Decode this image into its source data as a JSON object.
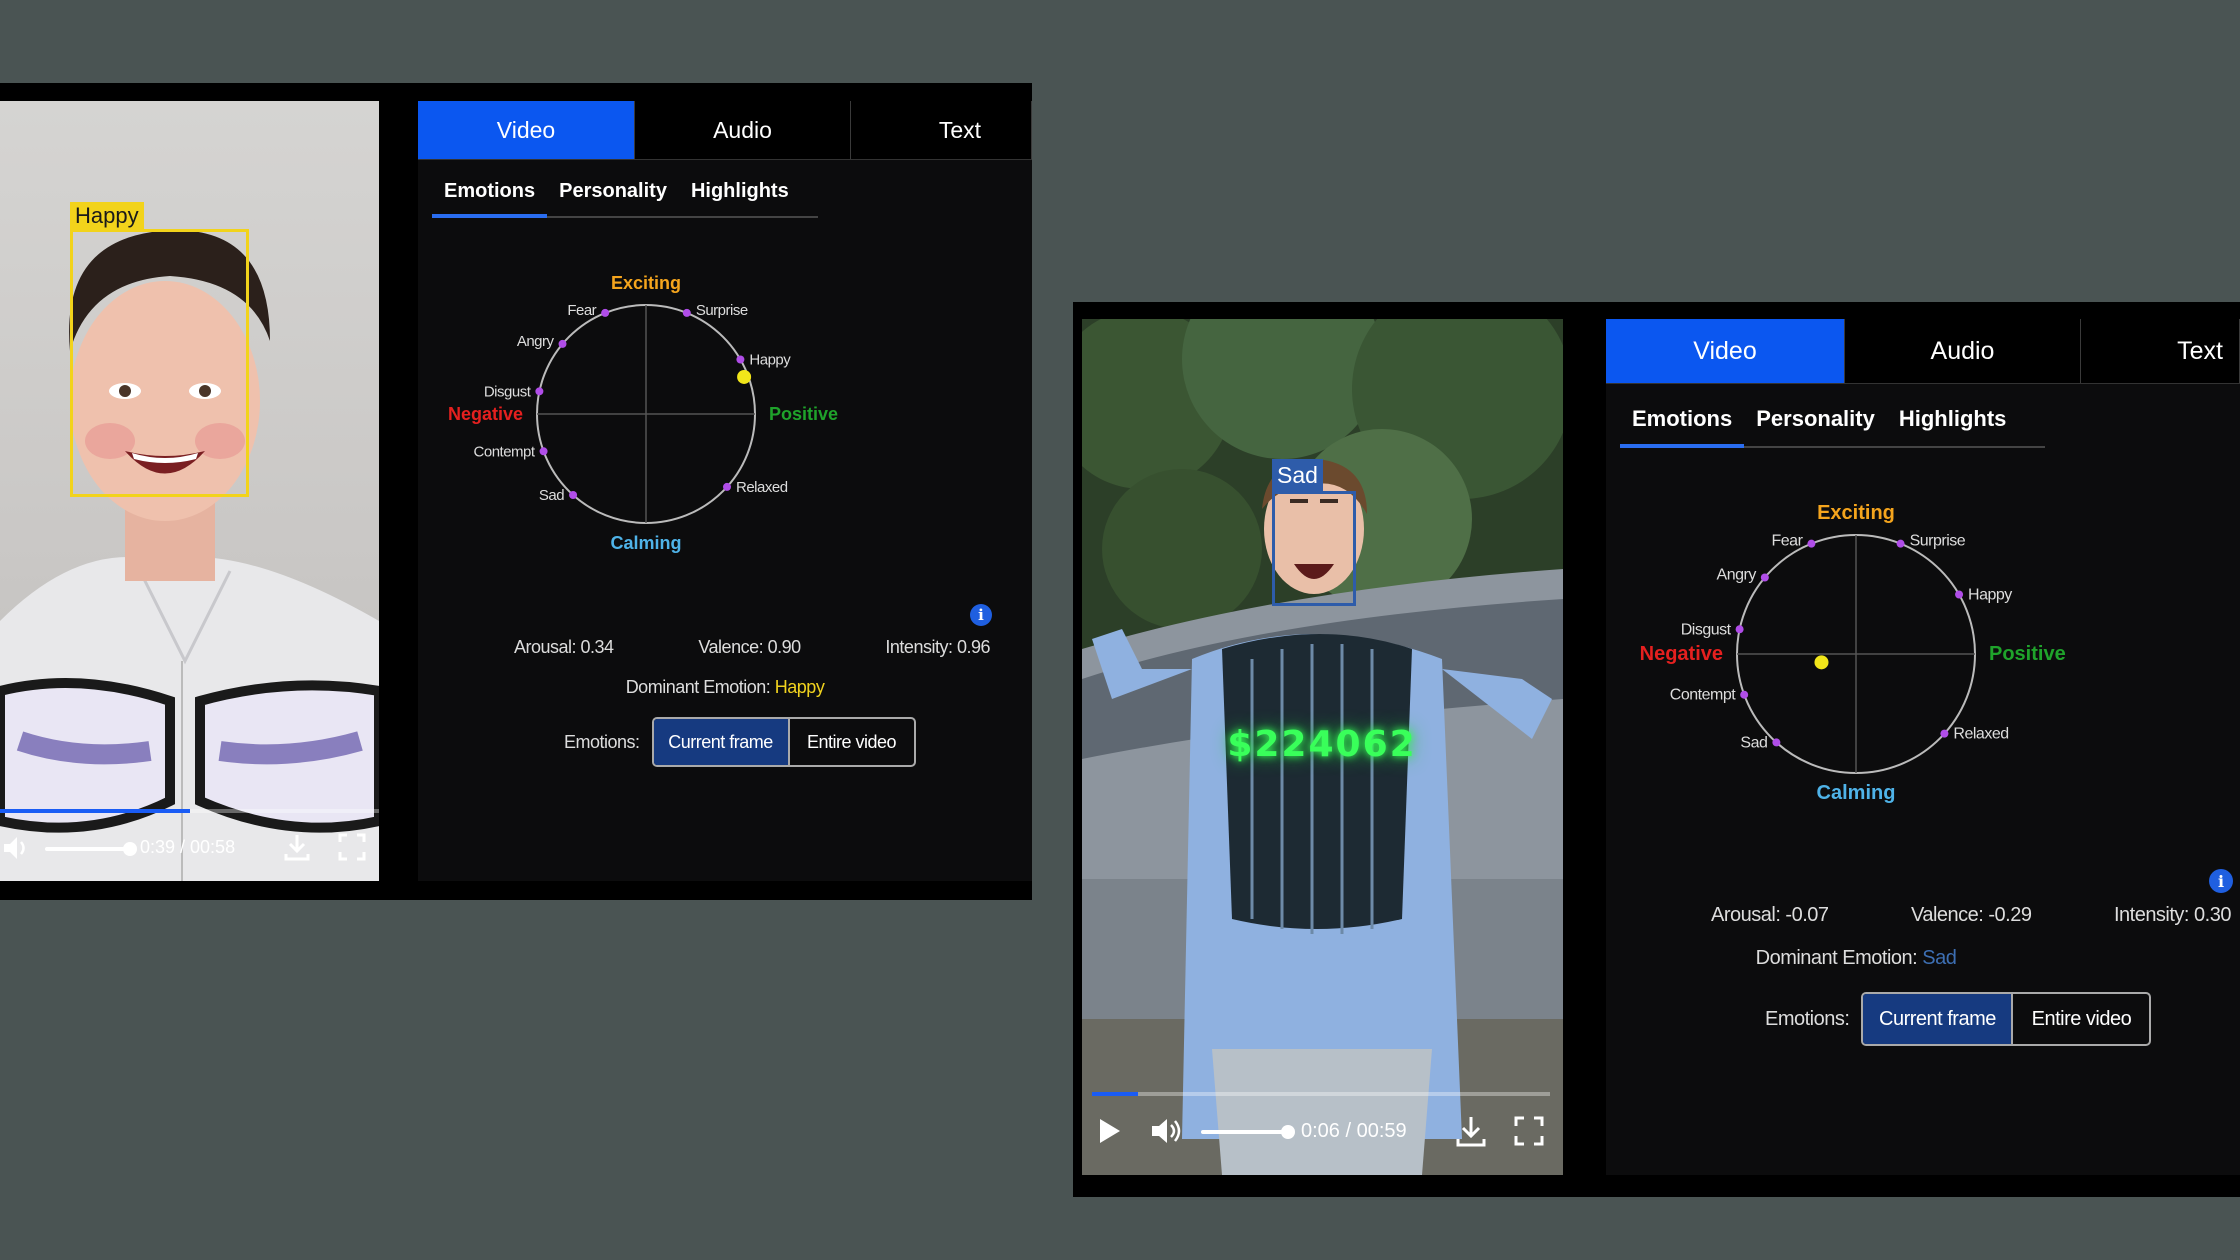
{
  "panels": [
    {
      "tabs": [
        "Video",
        "Audio",
        "Text"
      ],
      "active_tab": 0,
      "subtabs": [
        "Emotions",
        "Personality",
        "Highlights"
      ],
      "active_subtab": 0,
      "wheel": {
        "top_label": "Exciting",
        "bottom_label": "Calming",
        "left_label": "Negative",
        "right_label": "Positive",
        "emotions": [
          {
            "name": "Fear",
            "angle": 112
          },
          {
            "name": "Surprise",
            "angle": 68
          },
          {
            "name": "Angry",
            "angle": 140
          },
          {
            "name": "Happy",
            "angle": 30
          },
          {
            "name": "Disgust",
            "angle": 168
          },
          {
            "name": "Contempt",
            "angle": 200
          },
          {
            "name": "Sad",
            "angle": 228
          },
          {
            "name": "Relaxed",
            "angle": 318
          }
        ],
        "marker": {
          "valence": 0.9,
          "arousal": 0.34
        }
      },
      "metrics": {
        "arousal": "Arousal: 0.34",
        "valence": "Valence: 0.90",
        "intensity": "Intensity: 0.96"
      },
      "dominant_label": "Dominant Emotion:",
      "dominant_value": "Happy",
      "dominant_color": "#f0d21e",
      "emotions_label": "Emotions:",
      "toggle": [
        "Current frame",
        "Entire video"
      ],
      "face_label": "Happy",
      "face_color": "#f2d31b",
      "time": "0:39 / 00:58",
      "overlay_text": "",
      "progress": 0.5
    },
    {
      "tabs": [
        "Video",
        "Audio",
        "Text"
      ],
      "active_tab": 0,
      "subtabs": [
        "Emotions",
        "Personality",
        "Highlights"
      ],
      "active_subtab": 0,
      "wheel": {
        "top_label": "Exciting",
        "bottom_label": "Calming",
        "left_label": "Negative",
        "right_label": "Positive",
        "emotions": [
          {
            "name": "Fear",
            "angle": 112
          },
          {
            "name": "Surprise",
            "angle": 68
          },
          {
            "name": "Angry",
            "angle": 140
          },
          {
            "name": "Happy",
            "angle": 30
          },
          {
            "name": "Disgust",
            "angle": 168
          },
          {
            "name": "Contempt",
            "angle": 200
          },
          {
            "name": "Sad",
            "angle": 228
          },
          {
            "name": "Relaxed",
            "angle": 318
          }
        ],
        "marker": {
          "valence": -0.29,
          "arousal": -0.07
        }
      },
      "metrics": {
        "arousal": "Arousal: -0.07",
        "valence": "Valence: -0.29",
        "intensity": "Intensity: 0.30"
      },
      "dominant_label": "Dominant Emotion:",
      "dominant_value": "Sad",
      "dominant_color": "#3d6fb3",
      "emotions_label": "Emotions:",
      "toggle": [
        "Current frame",
        "Entire video"
      ],
      "face_label": "Sad",
      "face_color": "#2e5caa",
      "time": "0:06 / 00:59",
      "overlay_text": "$224062",
      "progress": 0.1
    }
  ],
  "colors": {
    "exciting": "#f5a51d",
    "calming": "#4fb3e8",
    "negative": "#e5201f",
    "positive": "#1fa32b",
    "dot": "#b04de8",
    "marker": "#f2e61a",
    "overlay": "#39ff5a"
  }
}
